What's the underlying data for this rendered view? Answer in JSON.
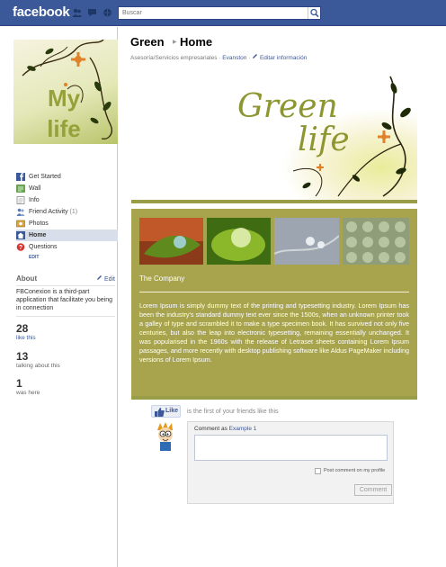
{
  "topbar": {
    "logo": "facebook",
    "search_placeholder": "Buscar"
  },
  "profile": {
    "picture_text_1": "My",
    "picture_text_2": "life"
  },
  "sidebar": {
    "items": [
      {
        "label": "Get Started",
        "icon": "facebook-icon"
      },
      {
        "label": "Wall",
        "icon": "wall-icon"
      },
      {
        "label": "Info",
        "icon": "info-icon"
      },
      {
        "label": "Friend Activity",
        "count": "(1)",
        "icon": "friends-icon"
      },
      {
        "label": "Photos",
        "icon": "photos-icon"
      },
      {
        "label": "Home",
        "icon": "home-icon",
        "active": true
      },
      {
        "label": "Questions",
        "icon": "questions-icon"
      }
    ],
    "edit_label": "EDIT"
  },
  "about": {
    "heading": "About",
    "edit": "Edit",
    "text": "FBConexion is a third-part application that facilitate you being in connection"
  },
  "stats": [
    {
      "number": "28",
      "label": "like this"
    },
    {
      "number": "13",
      "label": "talking about this"
    },
    {
      "number": "1",
      "label": "was here"
    }
  ],
  "page": {
    "title": "Green",
    "tab_title": "Home",
    "category": "Asesoría/Servicios empresariales",
    "location": "Evanston",
    "edit_info": "Editar información"
  },
  "banner": {
    "line1": "Green",
    "line2": "life"
  },
  "content": {
    "heading": "The Company",
    "body": "Lorem Ipsum is simply dummy text of the printing and typesetting industry. Lorem Ipsum has been the industry's standard dummy text ever since the 1500s, when an unknown printer took a galley of type and scrambled it to make a type specimen book. It has survived not only five centuries, but also the leap into electronic typesetting, remaining essentially unchanged. It was popularised in the 1960s with the release of Letraset sheets containing Lorem Ipsum passages, and more recently with desktop publishing software like Aldus PageMaker including versions of Lorem Ipsum."
  },
  "social": {
    "like_button": "Like",
    "like_text": "is the first of your friends like this",
    "comment_as": "Comment as",
    "comment_user": "Example 1",
    "post_on_profile": "Post comment on my profile",
    "comment_button": "Comment"
  },
  "colors": {
    "brand": "#3b5998",
    "olive": "#a8a44e",
    "banner_text": "#8d9630"
  }
}
